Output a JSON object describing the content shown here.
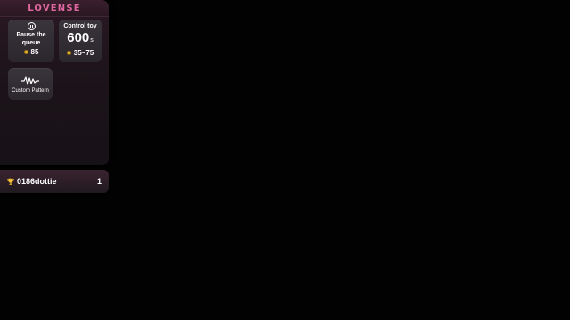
{
  "panel": {
    "logo": "LOVENSE",
    "tiles": {
      "pause": {
        "title": "Pause the queue",
        "price": "85",
        "icon": "pause-circle-icon"
      },
      "control": {
        "title": "Control toy",
        "duration": "600",
        "unit": "s",
        "price": "35~75",
        "icon": "coin-icon"
      },
      "custom": {
        "label": "Custom Pattern",
        "icon": "wave-icon"
      }
    }
  },
  "leaderboard": {
    "icon": "trophy-icon",
    "name": "0186dottie",
    "count": "1"
  },
  "colors": {
    "brand": "#e0679f",
    "coin": "#f5c232",
    "background": "#020203"
  }
}
